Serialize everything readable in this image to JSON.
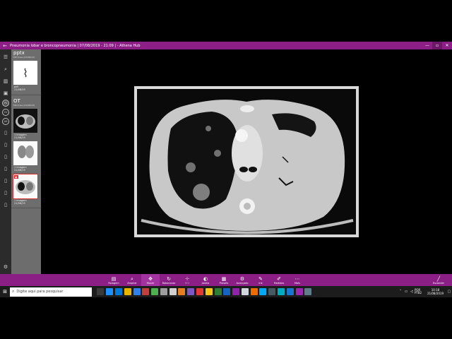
{
  "window": {
    "title": "Pneumonia lobar e broncopneumonia | 07/08/2019 - 21:09 | - Athena Hub",
    "back_icon": "arrow-left-icon",
    "colors": {
      "accent": "#8b1f86",
      "rail": "#2b2b2b",
      "panel": "#6d6d6d"
    }
  },
  "rail": {
    "items": [
      {
        "icon": "menu-icon",
        "glyph": "☰"
      },
      {
        "icon": "search-icon",
        "glyph": "⌕"
      },
      {
        "icon": "library-icon",
        "glyph": "▥"
      },
      {
        "icon": "image-icon",
        "glyph": "▣"
      }
    ],
    "circles": [
      "PS",
      "CV",
      "AX"
    ],
    "settings_glyph": "⚙"
  },
  "series": [
    {
      "name": "pptx",
      "subtitle": "MR Knee (22/08/19)",
      "thumbs": [
        {
          "kind": "file",
          "line1": "pdf",
          "line2": "",
          "line3": "21/08/19"
        }
      ]
    },
    {
      "name": "OT",
      "subtitle": "MR Knee (22/08/19)",
      "thumbs": [
        {
          "kind": "ct",
          "line1": "",
          "line2": "1 Imagem",
          "line3": "21/08/19"
        },
        {
          "kind": "xray",
          "line1": "",
          "line2": "1 Imagem",
          "line3": "21/08/19"
        },
        {
          "kind": "ct-selected",
          "line1": "",
          "line2": "1 Imagem",
          "line3": "21/08/19"
        }
      ]
    }
  ],
  "toolbar": {
    "tools": [
      {
        "label": "Rolagem",
        "glyph": "▤",
        "icon": "scroll-icon",
        "state": "normal"
      },
      {
        "label": "Ampliar",
        "glyph": "⌕",
        "icon": "zoom-icon",
        "state": "normal"
      },
      {
        "label": "Mover",
        "glyph": "✥",
        "icon": "move-icon",
        "state": "active"
      },
      {
        "label": "Rotacionar",
        "glyph": "↻",
        "icon": "rotate-icon",
        "state": "normal"
      },
      {
        "label": "ROI",
        "glyph": "✛",
        "icon": "roi-icon",
        "state": "disabled"
      },
      {
        "label": "Janela",
        "glyph": "◐",
        "icon": "window-level-icon",
        "state": "normal"
      },
      {
        "label": "Presets",
        "glyph": "▦",
        "icon": "presets-icon",
        "state": "normal"
      },
      {
        "label": "Avançado",
        "glyph": "⚙",
        "icon": "advanced-icon",
        "state": "normal"
      },
      {
        "label": "Ink",
        "glyph": "✎",
        "icon": "ink-icon",
        "state": "normal"
      },
      {
        "label": "Medidas",
        "glyph": "✐",
        "icon": "measure-icon",
        "state": "normal"
      },
      {
        "label": "Mais",
        "glyph": "⋯",
        "icon": "more-icon",
        "state": "normal"
      }
    ],
    "right_label": "Esconder",
    "right_glyph": "╱"
  },
  "taskbar": {
    "start_glyph": "⊞",
    "search_placeholder": "Digite aqui para pesquisar",
    "app_colors": [
      "#3a3a3a",
      "#1e90ff",
      "#0078d7",
      "#e8b400",
      "#2f80ed",
      "#c04040",
      "#4caf50",
      "#9e9e9e",
      "#d0d0d0",
      "#e67e22",
      "#7e57c2",
      "#e53935",
      "#f5c518",
      "#2e7d32",
      "#1565c0",
      "#8e24aa",
      "#cfd8dc",
      "#ef6c00",
      "#03a9f4",
      "#455a64",
      "#00acc1",
      "#1976d2",
      "#9c27b0",
      "#607d8b"
    ],
    "clock_time": "10:18",
    "clock_date": "21/08/2019",
    "lang": "POR PTB2"
  }
}
